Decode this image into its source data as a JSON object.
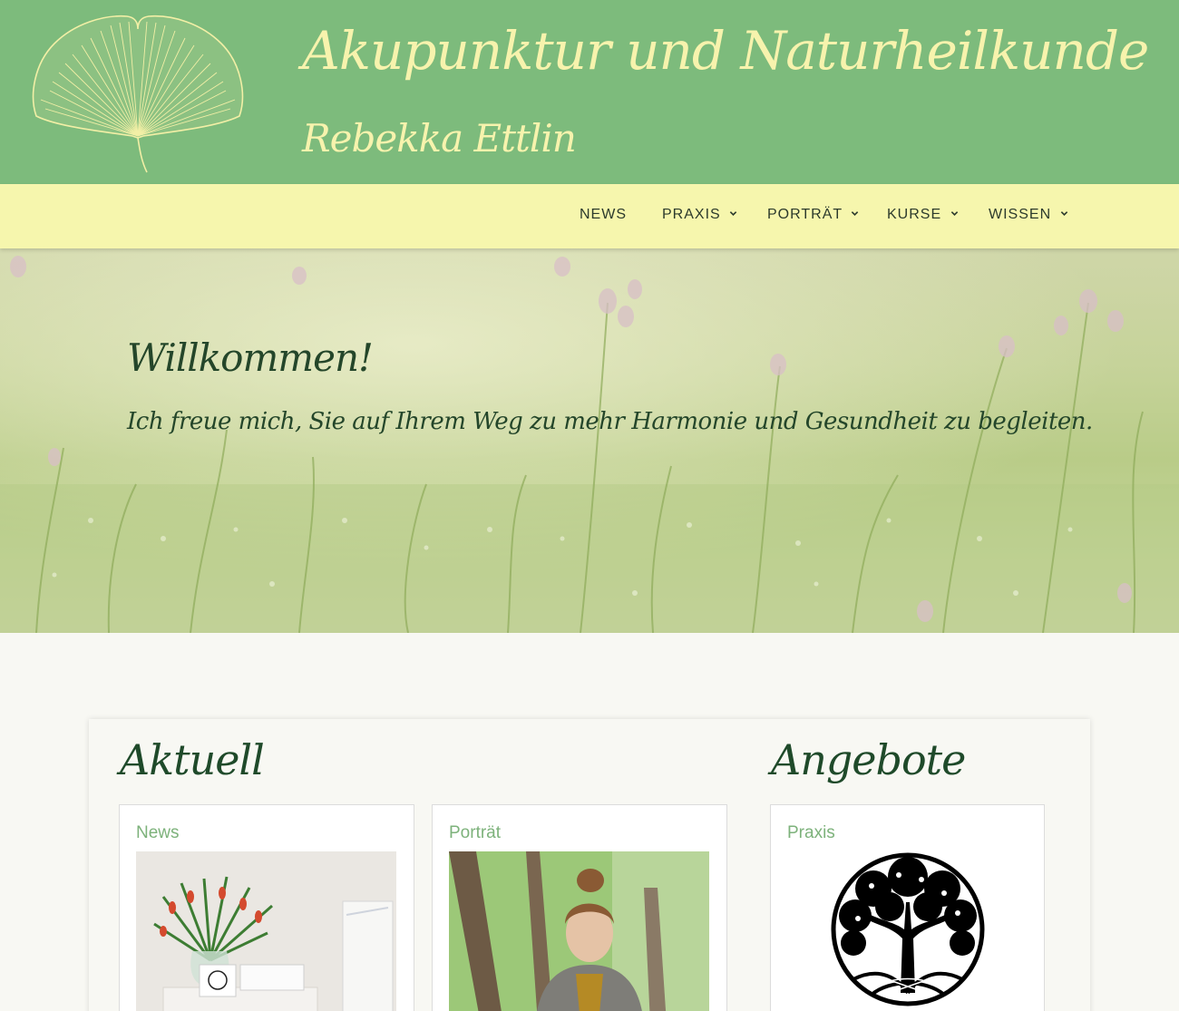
{
  "header": {
    "title": "Akupunktur und Naturheilkunde",
    "subtitle": "Rebekka Ettlin",
    "logo": "ginkgo-leaf-logo",
    "colors": {
      "background": "#7dbb7c",
      "text": "#f7f3ad"
    }
  },
  "nav": {
    "background": "#f6f6ad",
    "items": [
      {
        "label": "NEWS",
        "has_dropdown": false
      },
      {
        "label": "PRAXIS",
        "has_dropdown": true
      },
      {
        "label": "PORTRÄT",
        "has_dropdown": true
      },
      {
        "label": "KURSE",
        "has_dropdown": true
      },
      {
        "label": "WISSEN",
        "has_dropdown": true
      }
    ]
  },
  "hero": {
    "title": "Willkommen!",
    "text": "Ich freue mich, Sie auf Ihrem Weg zu mehr Harmonie und Gesundheit zu begleiten.",
    "image": "meadow-flowers-photo"
  },
  "sections": {
    "aktuell": {
      "title": "Aktuell",
      "cards": [
        {
          "title": "News",
          "image": "tulips-table-photo"
        },
        {
          "title": "Porträt",
          "image": "portrait-woman-photo"
        }
      ]
    },
    "angebote": {
      "title": "Angebote",
      "cards": [
        {
          "title": "Praxis",
          "image": "tree-of-life-icon"
        }
      ]
    }
  }
}
